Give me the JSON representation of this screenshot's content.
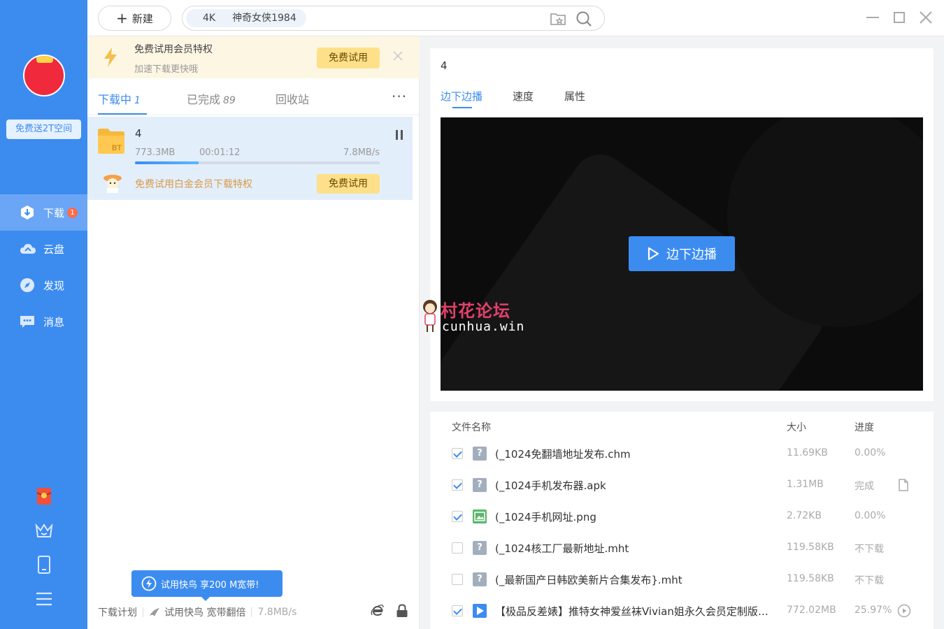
{
  "colors": {
    "accent": "#3c8cf0",
    "sidebar": "#3c8cf0",
    "vip_bg": "#fdf6e3",
    "vip_btn": "#ffe08a",
    "task_bg": "#e3eefb"
  },
  "sidebar": {
    "promo": "免费送2T空间",
    "items": [
      {
        "label": "下载",
        "icon": "download-icon",
        "badge": "1"
      },
      {
        "label": "云盘",
        "icon": "cloud-icon"
      },
      {
        "label": "发现",
        "icon": "compass-icon"
      },
      {
        "label": "消息",
        "icon": "message-icon"
      }
    ],
    "bottom_icons": [
      "red-envelope-icon",
      "crown-icon",
      "phone-icon",
      "menu-icon"
    ]
  },
  "topbar": {
    "new_label": "新建",
    "search_chip_1": "4K",
    "search_chip_2": "神奇女侠1984",
    "icons": [
      "favorite-folder-icon",
      "search-icon",
      "minimize-icon",
      "maximize-icon",
      "close-icon"
    ]
  },
  "vip_banner": {
    "title": "免费试用会员特权",
    "subtitle": "加速下载更快哦",
    "button": "免费试用"
  },
  "tabs": [
    {
      "label": "下载中",
      "count": "1"
    },
    {
      "label": "已完成",
      "count": "89"
    },
    {
      "label": "回收站",
      "count": ""
    }
  ],
  "more_label": "···",
  "task": {
    "name": "4",
    "icon_label": "BT",
    "size": "773.3MB",
    "time": "00:01:12",
    "speed": "7.8MB/s",
    "progress": 0.26,
    "vip_text": "免费试用白金会员下载特权",
    "vip_button": "免费试用"
  },
  "float_tip": "试用快鸟 享200 M宽带!",
  "bottom_bar": {
    "plan": "下载计划",
    "boost": "试用快鸟 宽带翻倍",
    "speed": "7.8MB/s"
  },
  "detail": {
    "title": "4",
    "tabs": [
      "边下边播",
      "速度",
      "属性"
    ],
    "play_button": "边下边播"
  },
  "files": {
    "headers": {
      "name": "文件名称",
      "size": "大小",
      "progress": "进度"
    },
    "rows": [
      {
        "checked": true,
        "type": "unk",
        "name": "(_1024免翻墙地址发布.chm",
        "size": "11.69KB",
        "progress": "0.00%",
        "action": ""
      },
      {
        "checked": true,
        "type": "unk",
        "name": "(_1024手机发布器.apk",
        "size": "1.31MB",
        "progress": "完成",
        "action": "file-icon"
      },
      {
        "checked": true,
        "type": "img",
        "name": "(_1024手机网址.png",
        "size": "2.72KB",
        "progress": "0.00%",
        "action": ""
      },
      {
        "checked": false,
        "type": "unk",
        "name": "(_1024核工厂最新地址.mht",
        "size": "119.58KB",
        "progress": "不下载",
        "action": ""
      },
      {
        "checked": false,
        "type": "unk",
        "name": "(_最新国产日韩欧美新片合集发布}.mht",
        "size": "119.58KB",
        "progress": "不下载",
        "action": ""
      },
      {
        "checked": true,
        "type": "vid",
        "name": "【极品反差婊】推特女神爱丝袜Vivian姐永久会员定制版流...",
        "size": "772.02MB",
        "progress": "25.97%",
        "action": "play-icon"
      }
    ]
  },
  "watermark": {
    "cn": "村花论坛",
    "en": "cunhua.win"
  }
}
